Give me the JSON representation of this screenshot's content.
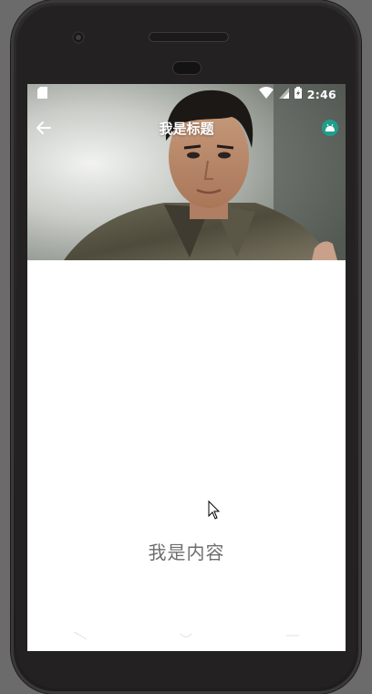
{
  "status_bar": {
    "time": "2:46",
    "icons": [
      "sd-card-icon",
      "wifi-icon",
      "signal-icon",
      "battery-charging-icon"
    ]
  },
  "toolbar": {
    "title": "我是标题",
    "back_icon": "arrow-back-icon",
    "action_icon": "android-robot-icon"
  },
  "content": {
    "text": "我是内容"
  },
  "navigation": {
    "buttons": [
      "nav-back-icon",
      "nav-home-icon",
      "nav-recents-icon"
    ]
  },
  "colors": {
    "action_accent": "#1f9e8d",
    "content_text": "#6e6e6e",
    "screen_background": "#ffffff"
  }
}
